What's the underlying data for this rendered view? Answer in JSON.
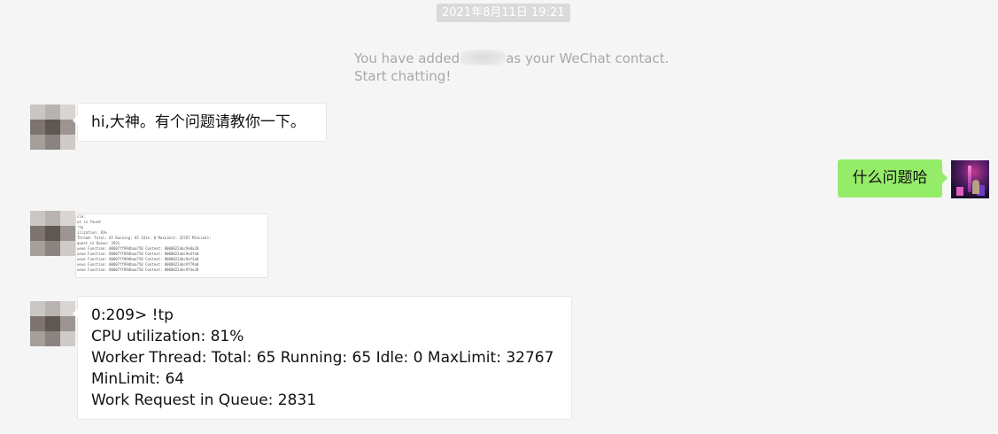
{
  "timestamp": "2021年8月11日 19:21",
  "system_message": {
    "prefix": "You have added",
    "suffix": "as your WeChat contact.",
    "line2": "Start chatting!"
  },
  "messages": [
    {
      "side": "left",
      "type": "text",
      "text": "hi,大神。有个问题请教你一下。"
    },
    {
      "side": "right",
      "type": "text",
      "text": "什么问题哈"
    },
    {
      "side": "left",
      "type": "image",
      "preview_lines": [
        "cle:",
        "ut in found",
        "!tp",
        "ilization: 81%",
        "Thread: Total: 65 Running: 65 Idle: 0 MaxLimit: 32767 MinLimit:",
        "quest in Queue: 2831",
        "ueue Function: 00007ff89dbaa750  Context: 0000022abc9e8a20",
        "ueue Function: 00007ff89dbaa750  Context: 0000022abc9e4fa0",
        "ueue Function: 00007ff89dbaa750  Context: 0000022abc9ef3a0",
        "ueue Function: 00007ff89dbaa750  Context: 0000022abc9f79a0",
        "ueue Function: 00007ff89dbaa750  Context: 0000022abc9f4e20"
      ]
    },
    {
      "side": "left",
      "type": "text",
      "lines": [
        "0:209> !tp",
        "CPU utilization: 81%",
        "Worker Thread: Total: 65 Running: 65 Idle: 0 MaxLimit: 32767",
        "MinLimit: 64",
        "Work Request in Queue: 2831"
      ]
    }
  ],
  "colors": {
    "background": "#f5f5f5",
    "sent_bubble": "#95ec69",
    "received_bubble": "#ffffff",
    "timestamp_bg": "#dadada",
    "system_text": "#a8a8a8"
  }
}
